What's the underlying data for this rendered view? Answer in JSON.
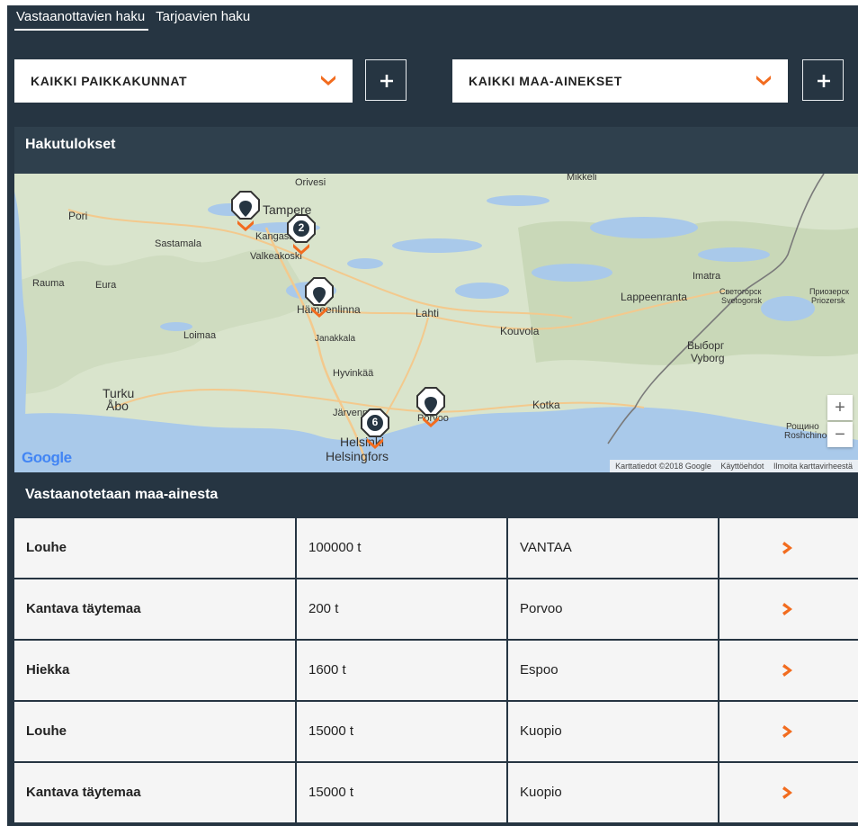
{
  "tabs": [
    {
      "label": "Vastaanottavien haku",
      "active": true
    },
    {
      "label": "Tarjoavien haku",
      "active": false
    }
  ],
  "filters": {
    "location_select": "KAIKKI PAIKKAKUNNAT",
    "material_select": "KAIKKI MAA-AINEKSET",
    "add_icon": "plus-icon",
    "chevron_icon": "chevron-down-icon"
  },
  "map_section": {
    "title": "Hakutulokset",
    "places": [
      "Orivesi",
      "Mikkeli",
      "Pori",
      "Tampere",
      "Kangasala",
      "Sastamala",
      "Valkeakoski",
      "Rauma",
      "Eura",
      "Hämeenlinna",
      "Lahti",
      "Imatra",
      "Lappeenranta",
      "Светогорск",
      "Svetogorsk",
      "Приозерск",
      "Priozersk",
      "Loimaa",
      "Janakkala",
      "Kouvola",
      "Выборг",
      "Vyborg",
      "Hyvinkää",
      "Turku",
      "Åbo",
      "Järvenpää",
      "Kotka",
      "Porvoo",
      "Helsinki",
      "Helsingfors",
      "Рощино",
      "Roshchino"
    ],
    "cluster_labels": [
      "2",
      "6"
    ],
    "zoom_in": "+",
    "zoom_out": "−",
    "logo": "Google",
    "attribution": "Karttatiedot ©2018 Google",
    "terms_link": "Käyttöehdot",
    "report_link": "Ilmoita karttavirheestä"
  },
  "results": {
    "title": "Vastaanotetaan maa-ainesta",
    "rows": [
      {
        "material": "Louhe",
        "amount": "100000 t",
        "location": "VANTAA"
      },
      {
        "material": "Kantava täytemaa",
        "amount": "200 t",
        "location": "Porvoo"
      },
      {
        "material": "Hiekka",
        "amount": "1600 t",
        "location": "Espoo"
      },
      {
        "material": "Louhe",
        "amount": "15000 t",
        "location": "Kuopio"
      },
      {
        "material": "Kantava täytemaa",
        "amount": "15000 t",
        "location": "Kuopio"
      }
    ],
    "row_arrow_icon": "chevron-right-icon"
  },
  "colors": {
    "background": "#263542",
    "accent": "#f26c1f",
    "row_bg": "#f5f5f5"
  }
}
